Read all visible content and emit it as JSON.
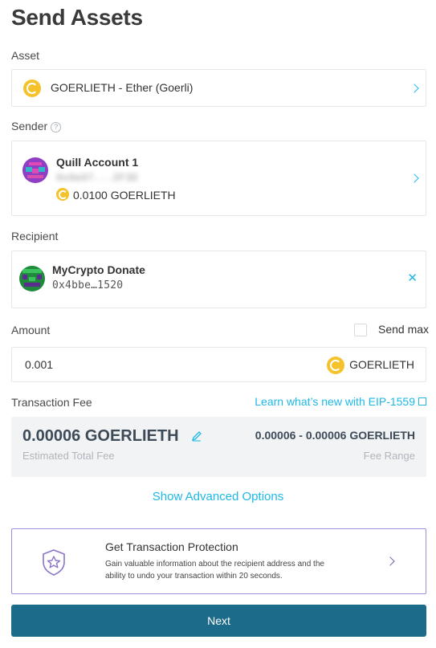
{
  "page": {
    "title": "Send Assets"
  },
  "asset": {
    "label": "Asset",
    "value": "GOERLIETH - Ether (Goerli)",
    "icon": "goerli-coin-icon"
  },
  "sender": {
    "label": "Sender",
    "help_icon": "question-icon",
    "account_name": "Quill Account 1",
    "address": "0x8a97...2F3D",
    "balance": "0.0100 GOERLIETH"
  },
  "recipient": {
    "label": "Recipient",
    "name": "MyCrypto Donate",
    "address": "0x4bbe…1520",
    "clear_icon": "close-icon"
  },
  "amount": {
    "label": "Amount",
    "send_max_label": "Send max",
    "value": "0.001",
    "unit": "GOERLIETH"
  },
  "fee": {
    "label": "Transaction Fee",
    "link": "Learn what’s new with EIP-1559",
    "total": "0.00006 GOERLIETH",
    "total_sub": "Estimated Total Fee",
    "range": "0.00006 - 0.00006 GOERLIETH",
    "range_sub": "Fee Range"
  },
  "advanced": {
    "label": "Show Advanced Options"
  },
  "protection": {
    "title": "Get Transaction Protection",
    "description": "Gain valuable information about the recipient address and the ability to undo your transaction within 20 seconds."
  },
  "next": {
    "label": "Next"
  },
  "colors": {
    "accent": "#1eb8e7",
    "primary_button": "#1d6b8a",
    "coin": "#f5c22b",
    "protection_border": "#a18bdb"
  }
}
